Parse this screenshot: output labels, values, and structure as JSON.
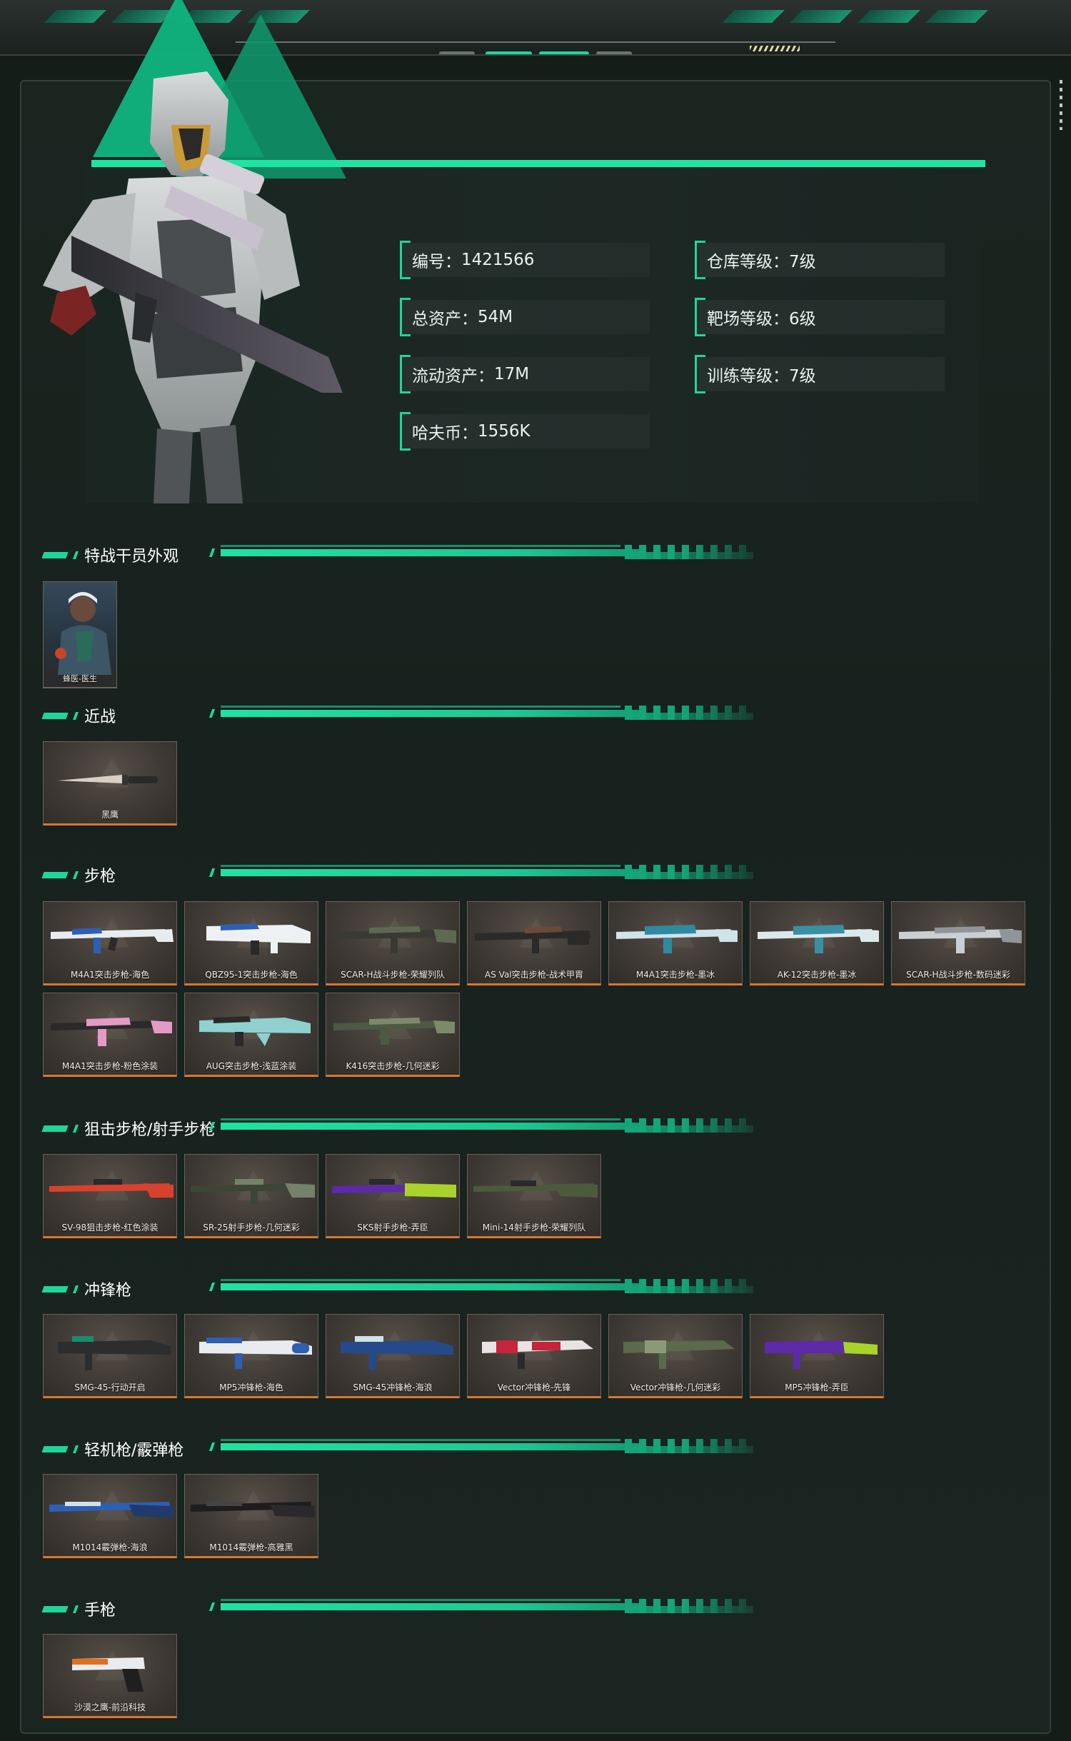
{
  "profile": {
    "stats": [
      {
        "label": "编号：",
        "value": "1421566"
      },
      {
        "label": "仓库等级：",
        "value": "7级"
      },
      {
        "label": "总资产：",
        "value": "54M"
      },
      {
        "label": "靶场等级：",
        "value": "6级"
      },
      {
        "label": "流动资产：",
        "value": "17M"
      },
      {
        "label": "训练等级：",
        "value": "7级"
      },
      {
        "label": "哈夫币：",
        "value": "1556K"
      }
    ]
  },
  "colors": {
    "accent": "#1fd59a",
    "card_border_bottom": "#d8772f",
    "background": "#151d19"
  },
  "sections": [
    {
      "title": "特战干员外观",
      "items": [
        "蜂医-医生"
      ]
    },
    {
      "title": "近战",
      "items": [
        "黑鹰"
      ]
    },
    {
      "title": "步枪",
      "items": [
        "M4A1突击步枪-海色",
        "QBZ95-1突击步枪-海色",
        "SCAR-H战斗步枪-荣耀列队",
        "AS Val突击步枪-战术甲胄",
        "M4A1突击步枪-墨冰",
        "AK-12突击步枪-墨冰",
        "SCAR-H战斗步枪-数码迷彩",
        "M4A1突击步枪-粉色涂装",
        "AUG突击步枪-浅蓝涂装",
        "K416突击步枪-几何迷彩"
      ]
    },
    {
      "title": "狙击步枪/射手步枪",
      "items": [
        "SV-98狙击步枪-红色涂装",
        "SR-25射手步枪-几何迷彩",
        "SKS射手步枪-弄臣",
        "Mini-14射手步枪-荣耀列队"
      ]
    },
    {
      "title": "冲锋枪",
      "items": [
        "SMG-45-行动开启",
        "MP5冲锋枪-海色",
        "SMG-45冲锋枪-海浪",
        "Vector冲锋枪-先锋",
        "Vector冲锋枪-几何迷彩",
        "MP5冲锋枪-弄臣"
      ]
    },
    {
      "title": "轻机枪/霰弹枪",
      "items": [
        "M1014霰弹枪-海浪",
        "M1014霰弹枪-高雅黑"
      ]
    },
    {
      "title": "手枪",
      "items": [
        "沙漠之鹰-前沿科技"
      ]
    }
  ]
}
